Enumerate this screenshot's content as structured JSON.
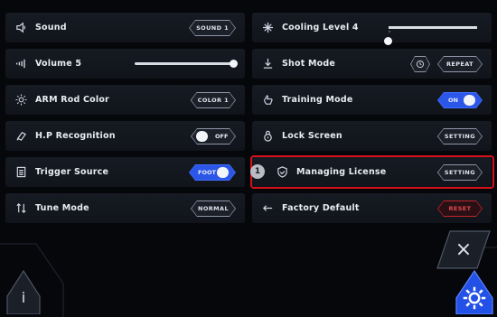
{
  "left": [
    {
      "label": "Sound",
      "control": "button",
      "value": "SOUND 1",
      "icon": "speaker-icon"
    },
    {
      "label": "Volume 5",
      "control": "slider",
      "level": 0.92,
      "icon": "volume-bars-icon"
    },
    {
      "label": "ARM Rod Color",
      "control": "button",
      "value": "COLOR 1",
      "icon": "sun-icon"
    },
    {
      "label": "H.P Recognition",
      "control": "toggle",
      "value": "OFF",
      "icon": "hp-icon"
    },
    {
      "label": "Trigger Source",
      "control": "toggle-on",
      "value": "FOOT",
      "icon": "document-icon"
    },
    {
      "label": "Tune Mode",
      "control": "button",
      "value": "NORMAL",
      "icon": "sort-arrows-icon"
    }
  ],
  "right": [
    {
      "label": "Cooling Level 4",
      "control": "cool-slider",
      "level": 1.0,
      "icon": "snowflake-icon"
    },
    {
      "label": "Shot Mode",
      "control": "button-icon",
      "value": "REPEAT",
      "icon": "download-icon"
    },
    {
      "label": "Training Mode",
      "control": "toggle-on",
      "value": "ON",
      "icon": "hand-icon"
    },
    {
      "label": "Lock Screen",
      "control": "button",
      "value": "SETTING",
      "icon": "lock-icon"
    },
    {
      "label": "Managing License",
      "control": "button",
      "value": "SETTING",
      "icon": "shield-check-icon",
      "marker": "1"
    },
    {
      "label": "Factory Default",
      "control": "button-red",
      "value": "RESET",
      "icon": "return-arrow-icon"
    }
  ],
  "bottom": {
    "info_label": "i",
    "close_label": "×"
  },
  "colors": {
    "background": "#06070b",
    "row": "#161a22",
    "accent": "#2b56e8",
    "reset": "#e24a4f",
    "highlight": "#d6111a"
  }
}
